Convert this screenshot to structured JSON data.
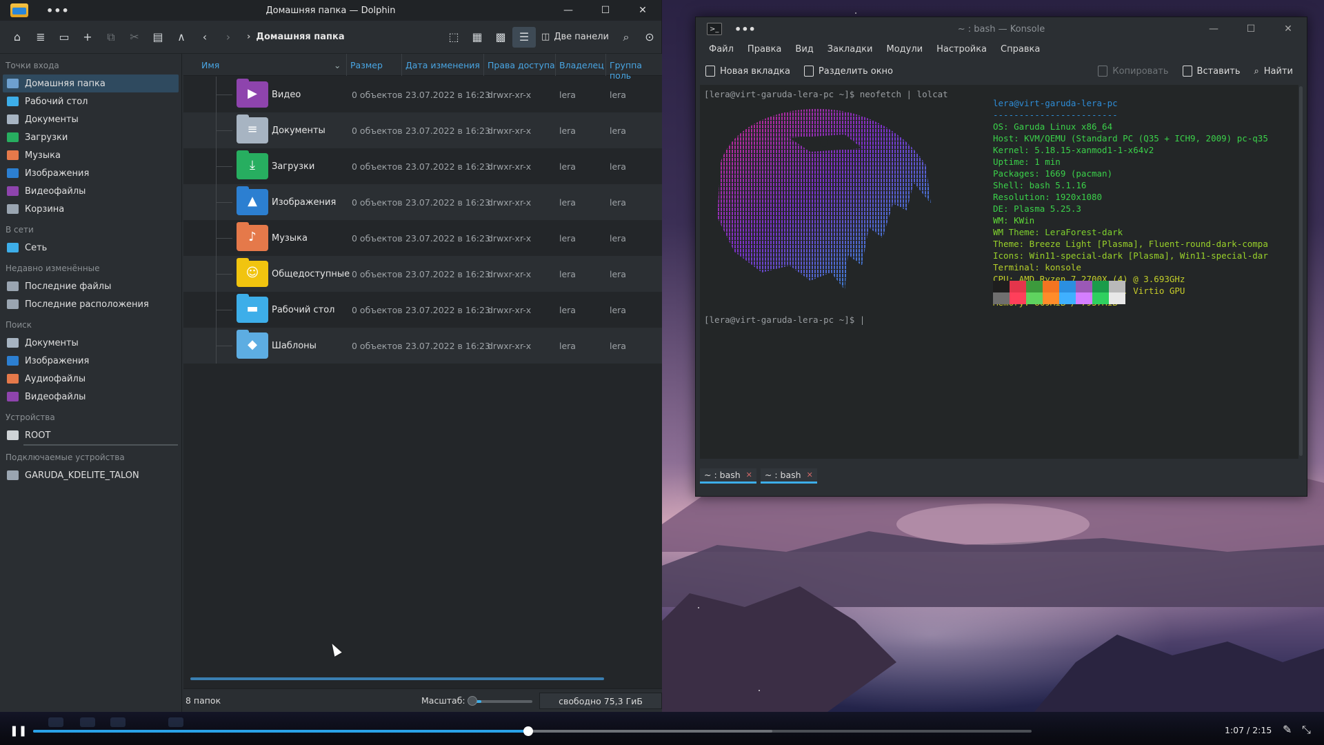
{
  "dolphin": {
    "title": "Домашняя папка — Dolphin",
    "dots": "•••",
    "breadcrumb": "Домашняя папка",
    "two_panels": "Две панели",
    "sidebar": {
      "sections": [
        {
          "title": "Точки входа",
          "items": [
            {
              "label": "Домашняя папка",
              "icon": "home-folder-icon",
              "color": "#6ea0cf",
              "selected": true
            },
            {
              "label": "Рабочий стол",
              "icon": "desktop-folder-icon",
              "color": "#3daee9"
            },
            {
              "label": "Документы",
              "icon": "documents-folder-icon",
              "color": "#a7b4c2"
            },
            {
              "label": "Загрузки",
              "icon": "downloads-folder-icon",
              "color": "#27ae60"
            },
            {
              "label": "Музыка",
              "icon": "music-folder-icon",
              "color": "#e5794a"
            },
            {
              "label": "Изображения",
              "icon": "pictures-folder-icon",
              "color": "#2c7fd1"
            },
            {
              "label": "Видеофайлы",
              "icon": "videos-folder-icon",
              "color": "#8e44ad"
            },
            {
              "label": "Корзина",
              "icon": "trash-icon",
              "color": "#9aa5b1"
            }
          ]
        },
        {
          "title": "В сети",
          "items": [
            {
              "label": "Сеть",
              "icon": "network-icon",
              "color": "#3daee9"
            }
          ]
        },
        {
          "title": "Недавно изменённые",
          "items": [
            {
              "label": "Последние файлы",
              "icon": "recent-files-icon",
              "color": "#9aa5b1"
            },
            {
              "label": "Последние расположения",
              "icon": "recent-locations-icon",
              "color": "#9aa5b1"
            }
          ]
        },
        {
          "title": "Поиск",
          "items": [
            {
              "label": "Документы",
              "icon": "search-documents-icon",
              "color": "#a7b4c2"
            },
            {
              "label": "Изображения",
              "icon": "search-images-icon",
              "color": "#2c7fd1"
            },
            {
              "label": "Аудиофайлы",
              "icon": "search-audio-icon",
              "color": "#e5794a"
            },
            {
              "label": "Видеофайлы",
              "icon": "search-video-icon",
              "color": "#8e44ad"
            }
          ]
        },
        {
          "title": "Устройства",
          "items": [
            {
              "label": "ROOT",
              "icon": "drive-icon",
              "color": "#cfd3d6"
            }
          ]
        },
        {
          "title": "Подключаемые устройства",
          "items": [
            {
              "label": "GARUDA_KDELITE_TALON",
              "icon": "optical-disc-icon",
              "color": "#9aa5b1"
            }
          ]
        }
      ]
    },
    "columns": [
      "Имя",
      "Размер",
      "Дата изменения",
      "Права доступа",
      "Владелец",
      "Группа поль"
    ],
    "rows": [
      {
        "name": "Видео",
        "size": "0 объектов",
        "date": "23.07.2022 в 16:23",
        "perm": "drwxr-xr-x",
        "owner": "lera",
        "group": "lera",
        "color": "#8e44ad",
        "glyph": "▶",
        "icon": "videos-folder-icon"
      },
      {
        "name": "Документы",
        "size": "0 объектов",
        "date": "23.07.2022 в 16:23",
        "perm": "drwxr-xr-x",
        "owner": "lera",
        "group": "lera",
        "color": "#a7b4c2",
        "glyph": "≡",
        "icon": "documents-folder-icon"
      },
      {
        "name": "Загрузки",
        "size": "0 объектов",
        "date": "23.07.2022 в 16:23",
        "perm": "drwxr-xr-x",
        "owner": "lera",
        "group": "lera",
        "color": "#27ae60",
        "glyph": "⤓",
        "icon": "downloads-folder-icon"
      },
      {
        "name": "Изображения",
        "size": "0 объектов",
        "date": "23.07.2022 в 16:23",
        "perm": "drwxr-xr-x",
        "owner": "lera",
        "group": "lera",
        "color": "#2c7fd1",
        "glyph": "▲",
        "icon": "pictures-folder-icon"
      },
      {
        "name": "Музыка",
        "size": "0 объектов",
        "date": "23.07.2022 в 16:23",
        "perm": "drwxr-xr-x",
        "owner": "lera",
        "group": "lera",
        "color": "#e5794a",
        "glyph": "♪",
        "icon": "music-folder-icon"
      },
      {
        "name": "Общедоступные",
        "size": "0 объектов",
        "date": "23.07.2022 в 16:23",
        "perm": "drwxr-xr-x",
        "owner": "lera",
        "group": "lera",
        "color": "#f1c40f",
        "glyph": "☺",
        "icon": "public-folder-icon"
      },
      {
        "name": "Рабочий стол",
        "size": "0 объектов",
        "date": "23.07.2022 в 16:23",
        "perm": "drwxr-xr-x",
        "owner": "lera",
        "group": "lera",
        "color": "#3daee9",
        "glyph": "▬",
        "icon": "desktop-folder-icon"
      },
      {
        "name": "Шаблоны",
        "size": "0 объектов",
        "date": "23.07.2022 в 16:23",
        "perm": "drwxr-xr-x",
        "owner": "lera",
        "group": "lera",
        "color": "#5dade2",
        "glyph": "◆",
        "icon": "templates-folder-icon"
      }
    ],
    "status": {
      "count": "8 папок",
      "zoom_label": "Масштаб:",
      "free": "свободно 75,3 ГиБ"
    }
  },
  "konsole": {
    "title": "~ : bash — Konsole",
    "dots": "•••",
    "menu": [
      "Файл",
      "Правка",
      "Вид",
      "Закладки",
      "Модули",
      "Настройка",
      "Справка"
    ],
    "toolbar": {
      "new_tab": "Новая вкладка",
      "split": "Разделить окно",
      "copy": "Копировать",
      "paste": "Вставить",
      "find": "Найти"
    },
    "prompt1": "[lera@virt-garuda-lera-pc ~]$ neofetch | lolcat",
    "prompt2": "[lera@virt-garuda-lera-pc ~]$ |",
    "neofetch": [
      "lera@virt-garuda-lera-pc",
      "------------------------",
      "OS: Garuda Linux x86_64",
      "Host: KVM/QEMU (Standard PC (Q35 + ICH9, 2009) pc-q35",
      "Kernel: 5.18.15-xanmod1-1-x64v2",
      "Uptime: 1 min",
      "Packages: 1669 (pacman)",
      "Shell: bash 5.1.16",
      "Resolution: 1920x1080",
      "DE: Plasma 5.25.3",
      "WM: KWin",
      "WM Theme: LeraForest-dark",
      "Theme: Breeze Light [Plasma], Fluent-round-dark-compa",
      "Icons: Win11-special-dark [Plasma], Win11-special-dar",
      "Terminal: konsole",
      "CPU: AMD Ryzen 7 2700X (4) @ 3.693GHz",
      "GPU: 00:01.0 Red Hat, Inc. Virtio GPU",
      "Memory: 869MiB / 7937MiB"
    ],
    "neofetch_colors": [
      "#2e8cd6",
      "#2e8cd6",
      "#3bd14a",
      "#3bd14a",
      "#3bd14a",
      "#3bd14a",
      "#3bd14a",
      "#3bd14a",
      "#3bd14a",
      "#3bd14a",
      "#5fd838",
      "#7fd22e",
      "#9ad22a",
      "#9ad22a",
      "#b6d02a",
      "#c3cf2a",
      "#c9cd2a",
      "#cfcb2a"
    ],
    "palette_top": [
      "#1e1e1e",
      "#e4354b",
      "#3c9a3c",
      "#f47421",
      "#2b8fe0",
      "#9b59b6",
      "#1a9c4a",
      "#b9b9b9"
    ],
    "palette_bottom": [
      "#6f6f6f",
      "#ff3f5a",
      "#5fd35f",
      "#ff8c2a",
      "#3fb0ff",
      "#d47eff",
      "#2fd05f",
      "#e8e8e8"
    ],
    "tabs": [
      "~ : bash",
      "~ : bash"
    ]
  },
  "player": {
    "time": "1:07 / 2:15",
    "progress": 0.496,
    "buffered": 0.74
  }
}
